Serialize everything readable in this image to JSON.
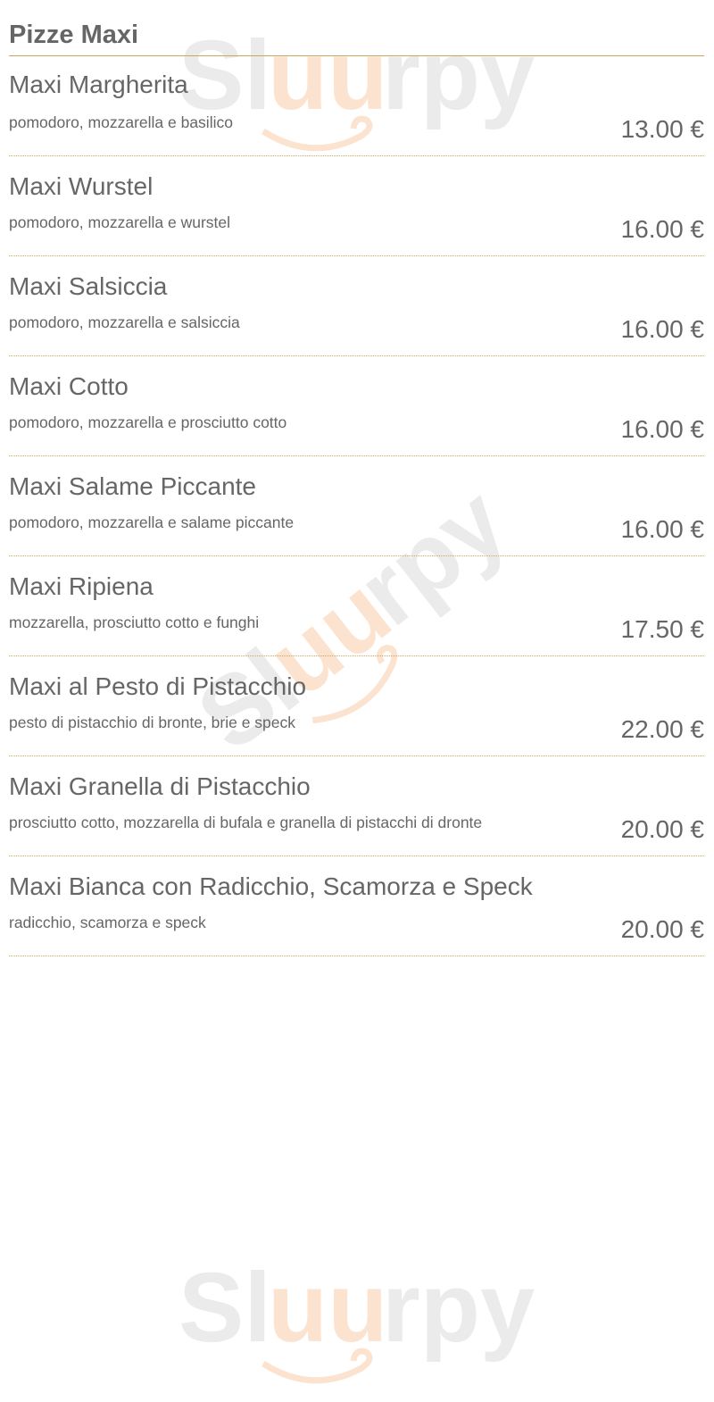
{
  "section": {
    "title": "Pizze Maxi"
  },
  "watermark": {
    "text": "Sluurpy"
  },
  "colors": {
    "divider": "#c9a75f",
    "text": "#666666",
    "watermark_grey": "#ebebeb",
    "watermark_orange": "#fbe3cf"
  },
  "items": [
    {
      "name": "Maxi Margherita",
      "description": "pomodoro, mozzarella e basilico",
      "price": "13.00 €"
    },
    {
      "name": "Maxi Wurstel",
      "description": "pomodoro, mozzarella e wurstel",
      "price": "16.00 €"
    },
    {
      "name": "Maxi Salsiccia",
      "description": "pomodoro, mozzarella e salsiccia",
      "price": "16.00 €"
    },
    {
      "name": "Maxi Cotto",
      "description": "pomodoro, mozzarella e prosciutto cotto",
      "price": "16.00 €"
    },
    {
      "name": "Maxi Salame Piccante",
      "description": "pomodoro, mozzarella e salame piccante",
      "price": "16.00 €"
    },
    {
      "name": "Maxi Ripiena",
      "description": "mozzarella, prosciutto cotto e funghi",
      "price": "17.50 €"
    },
    {
      "name": "Maxi al Pesto di Pistacchio",
      "description": "pesto di pistacchio di bronte, brie e speck",
      "price": "22.00 €"
    },
    {
      "name": "Maxi Granella di Pistacchio",
      "description": "prosciutto cotto, mozzarella di bufala e granella di pistacchi di dronte",
      "price": "20.00 €"
    },
    {
      "name": "Maxi Bianca con Radicchio, Scamorza e Speck",
      "description": "radicchio, scamorza e speck",
      "price": "20.00 €"
    }
  ]
}
